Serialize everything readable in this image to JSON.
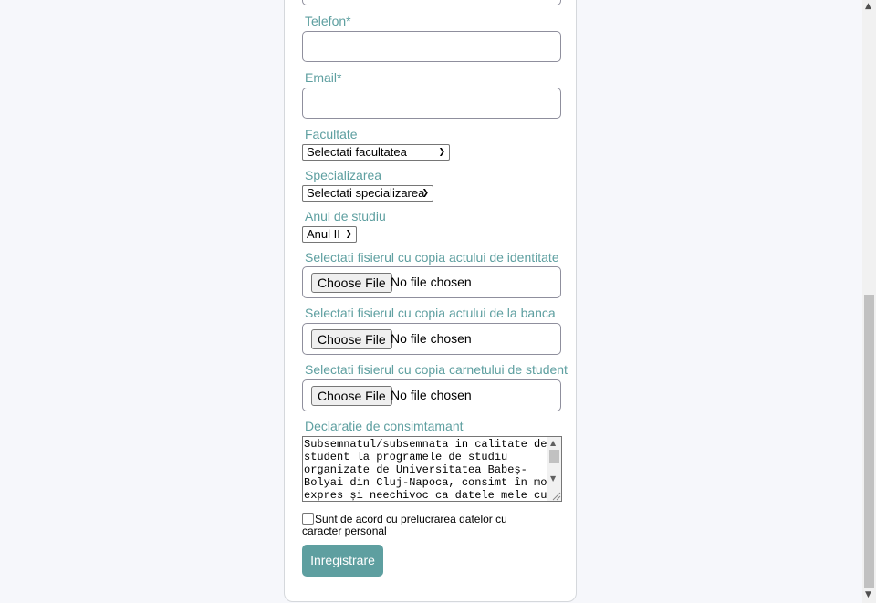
{
  "form": {
    "phone_label": "Telefon*",
    "email_label": "Email*",
    "faculty_label": "Facultate",
    "faculty_selected": "Selectati facultatea",
    "specialization_label": "Specializarea",
    "specialization_selected": "Selectati specializarea",
    "year_label": "Anul de studiu",
    "year_selected": "Anul II",
    "id_copy_label": "Selectati fisierul cu copia actului de identitate",
    "bank_copy_label": "Selectati fisierul cu copia actului de la banca",
    "student_card_label": "Selectati fisierul cu copia carnetului de student",
    "choose_file_label": "Choose File",
    "no_file_text": "No file chosen",
    "consent_declaration_label": "Declaratie de consimtamant",
    "consent_declaration_text": "Subsemnatul/subsemnata in calitate de\nstudent la programele de studiu\norganizate de Universitatea Babeș-\nBolyai din Cluj-Napoca, consimt în mod\nexpres și neechivoc ca datele mele cu",
    "agree_checkbox_label": "Sunt de acord cu prelucrarea datelor cu caracter personal",
    "agree_checked": false,
    "submit_label": "Inregistrare"
  },
  "colors": {
    "accent": "#5e9fa0",
    "page_background": "#f6f7fb",
    "card_background": "#ffffff"
  },
  "icons": {
    "select_arrow": "chevron-down-icon",
    "scroll_up": "scroll-up-arrow-icon",
    "scroll_down": "scroll-down-arrow-icon",
    "resize": "resize-grip-icon"
  }
}
